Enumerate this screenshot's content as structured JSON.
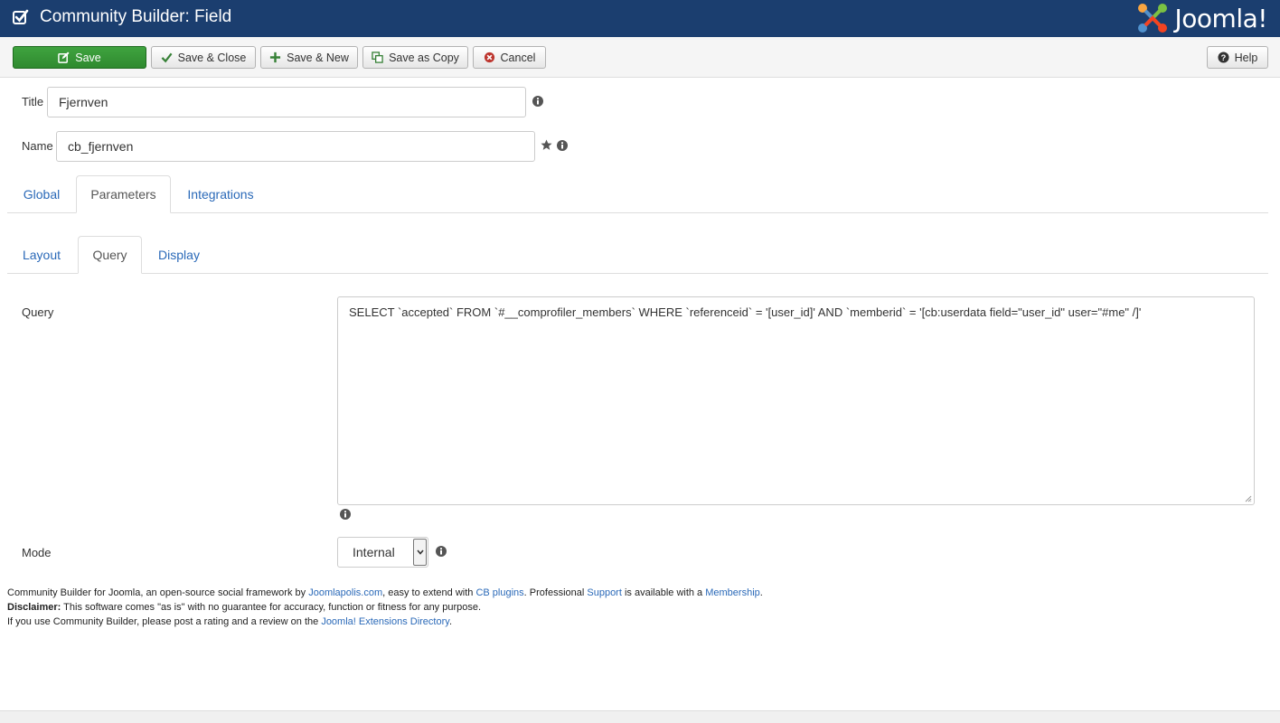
{
  "header": {
    "title": "Community Builder: Field",
    "logo_text": "Joomla!"
  },
  "toolbar": {
    "save_label": "Save",
    "save_close_label": "Save & Close",
    "save_new_label": "Save & New",
    "save_copy_label": "Save as Copy",
    "cancel_label": "Cancel",
    "help_label": "Help"
  },
  "form": {
    "title_label": "Title",
    "title_value": "Fjernven",
    "name_label": "Name",
    "name_value": "cb_fjernven"
  },
  "main_tabs": [
    {
      "label": "Global"
    },
    {
      "label": "Parameters",
      "active": true
    },
    {
      "label": "Integrations"
    }
  ],
  "sub_tabs": [
    {
      "label": "Layout"
    },
    {
      "label": "Query",
      "active": true
    },
    {
      "label": "Display"
    }
  ],
  "query": {
    "label": "Query",
    "value": "SELECT `accepted` FROM `#__comprofiler_members` WHERE `referenceid` = '[user_id]' AND `memberid` = '[cb:userdata field=\"user_id\" user=\"#me\" /]'"
  },
  "mode": {
    "label": "Mode",
    "selected": "Internal"
  },
  "footer": {
    "line1_part1": "Community Builder for Joomla, an open-source social framework by ",
    "line1_link1": "Joomlapolis.com",
    "line1_part2": ", easy to extend with ",
    "line1_link2": "CB plugins",
    "line1_part3": ". Professional ",
    "line1_link3": "Support",
    "line1_part4": " is available with a ",
    "line1_link4": "Membership",
    "line1_part5": ".",
    "line2_bold": "Disclaimer:",
    "line2_text": " This software comes \"as is\" with no guarantee for accuracy, function or fitness for any purpose.",
    "line3_part1": "If you use Community Builder, please post a rating and a review on the ",
    "line3_link": "Joomla! Extensions Directory",
    "line3_part2": "."
  },
  "colors": {
    "header_bg": "#1b3e6f",
    "save_green": "#3fa33f",
    "link_blue": "#2a69b8"
  }
}
